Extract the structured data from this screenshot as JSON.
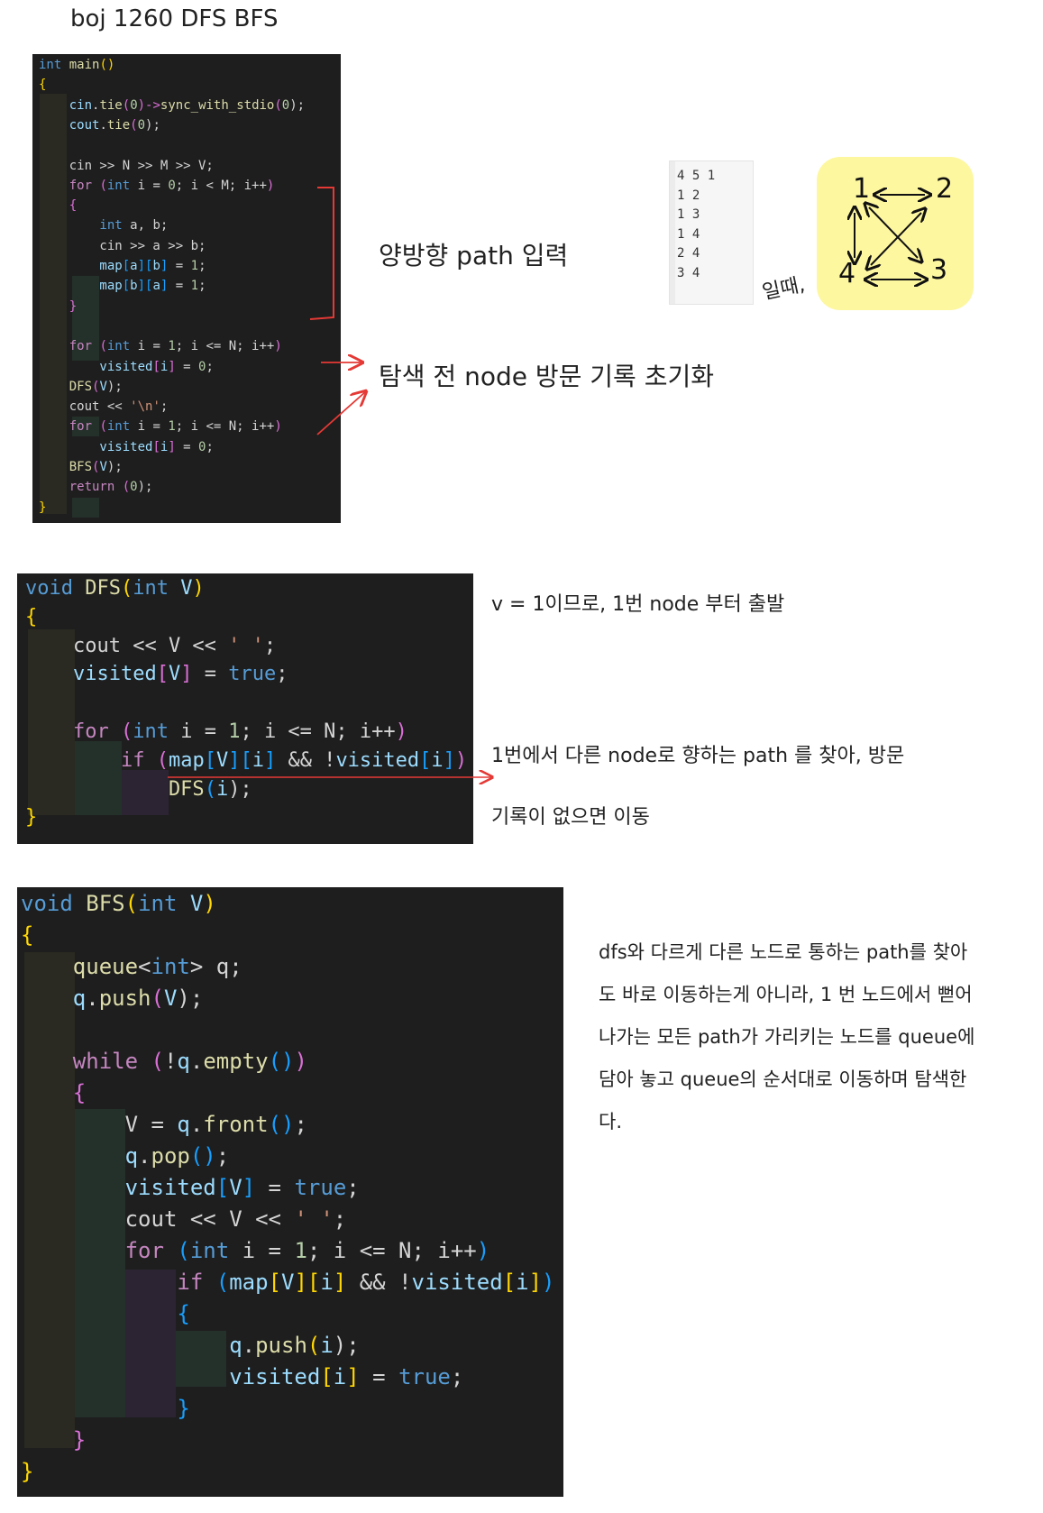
{
  "title": "boj 1260 DFS BFS",
  "main_code": {
    "lines": [
      [
        {
          "t": "int ",
          "c": "kw"
        },
        {
          "t": "main",
          "c": "fn"
        },
        {
          "t": "()",
          "c": "br"
        }
      ],
      [
        {
          "t": "{",
          "c": "br"
        }
      ],
      [
        {
          "t": "    cin",
          "c": "var"
        },
        {
          "t": ".",
          "c": "txt"
        },
        {
          "t": "tie",
          "c": "fn"
        },
        {
          "t": "(",
          "c": "br2"
        },
        {
          "t": "0",
          "c": "num"
        },
        {
          "t": ")->",
          "c": "br2"
        },
        {
          "t": "sync_with_stdio",
          "c": "fn"
        },
        {
          "t": "(",
          "c": "br2"
        },
        {
          "t": "0",
          "c": "num"
        },
        {
          "t": ");",
          "c": "txt"
        }
      ],
      [
        {
          "t": "    cout",
          "c": "var"
        },
        {
          "t": ".",
          "c": "txt"
        },
        {
          "t": "tie",
          "c": "fn"
        },
        {
          "t": "(",
          "c": "br2"
        },
        {
          "t": "0",
          "c": "num"
        },
        {
          "t": ");",
          "c": "txt"
        }
      ],
      [],
      [
        {
          "t": "    cin >> N >> M >> V;",
          "c": "txt"
        }
      ],
      [
        {
          "t": "    for ",
          "c": "ctl"
        },
        {
          "t": "(",
          "c": "br2"
        },
        {
          "t": "int ",
          "c": "kw"
        },
        {
          "t": "i = ",
          "c": "txt"
        },
        {
          "t": "0",
          "c": "num"
        },
        {
          "t": "; i < M; i++",
          "c": "txt"
        },
        {
          "t": ")",
          "c": "br2"
        }
      ],
      [
        {
          "t": "    {",
          "c": "br2"
        }
      ],
      [
        {
          "t": "        int ",
          "c": "kw"
        },
        {
          "t": "a, b;",
          "c": "txt"
        }
      ],
      [
        {
          "t": "        cin >> a >> b;",
          "c": "txt"
        }
      ],
      [
        {
          "t": "        map",
          "c": "var"
        },
        {
          "t": "[",
          "c": "br3"
        },
        {
          "t": "a",
          "c": "var"
        },
        {
          "t": "][",
          "c": "br3"
        },
        {
          "t": "b",
          "c": "var"
        },
        {
          "t": "]",
          "c": "br3"
        },
        {
          "t": " = ",
          "c": "txt"
        },
        {
          "t": "1",
          "c": "num"
        },
        {
          "t": ";",
          "c": "txt"
        }
      ],
      [
        {
          "t": "        map",
          "c": "var"
        },
        {
          "t": "[",
          "c": "br3"
        },
        {
          "t": "b",
          "c": "var"
        },
        {
          "t": "][",
          "c": "br3"
        },
        {
          "t": "a",
          "c": "var"
        },
        {
          "t": "]",
          "c": "br3"
        },
        {
          "t": " = ",
          "c": "txt"
        },
        {
          "t": "1",
          "c": "num"
        },
        {
          "t": ";",
          "c": "txt"
        }
      ],
      [
        {
          "t": "    }",
          "c": "br2"
        }
      ],
      [],
      [
        {
          "t": "    for ",
          "c": "ctl"
        },
        {
          "t": "(",
          "c": "br2"
        },
        {
          "t": "int ",
          "c": "kw"
        },
        {
          "t": "i = ",
          "c": "txt"
        },
        {
          "t": "1",
          "c": "num"
        },
        {
          "t": "; i <= N; i++",
          "c": "txt"
        },
        {
          "t": ")",
          "c": "br2"
        }
      ],
      [
        {
          "t": "        visited",
          "c": "var"
        },
        {
          "t": "[",
          "c": "br2"
        },
        {
          "t": "i",
          "c": "var"
        },
        {
          "t": "]",
          "c": "br2"
        },
        {
          "t": " = ",
          "c": "txt"
        },
        {
          "t": "0",
          "c": "num"
        },
        {
          "t": ";",
          "c": "txt"
        }
      ],
      [
        {
          "t": "    DFS",
          "c": "fn"
        },
        {
          "t": "(",
          "c": "br2"
        },
        {
          "t": "V",
          "c": "var"
        },
        {
          "t": ");",
          "c": "txt"
        }
      ],
      [
        {
          "t": "    cout << ",
          "c": "txt"
        },
        {
          "t": "'\\n'",
          "c": "str"
        },
        {
          "t": ";",
          "c": "txt"
        }
      ],
      [
        {
          "t": "    for ",
          "c": "ctl"
        },
        {
          "t": "(",
          "c": "br2"
        },
        {
          "t": "int ",
          "c": "kw"
        },
        {
          "t": "i = ",
          "c": "txt"
        },
        {
          "t": "1",
          "c": "num"
        },
        {
          "t": "; i <= N; i++",
          "c": "txt"
        },
        {
          "t": ")",
          "c": "br2"
        }
      ],
      [
        {
          "t": "        visited",
          "c": "var"
        },
        {
          "t": "[",
          "c": "br2"
        },
        {
          "t": "i",
          "c": "var"
        },
        {
          "t": "]",
          "c": "br2"
        },
        {
          "t": " = ",
          "c": "txt"
        },
        {
          "t": "0",
          "c": "num"
        },
        {
          "t": ";",
          "c": "txt"
        }
      ],
      [
        {
          "t": "    BFS",
          "c": "fn"
        },
        {
          "t": "(",
          "c": "br2"
        },
        {
          "t": "V",
          "c": "var"
        },
        {
          "t": ");",
          "c": "txt"
        }
      ],
      [
        {
          "t": "    return ",
          "c": "ctl"
        },
        {
          "t": "(",
          "c": "br2"
        },
        {
          "t": "0",
          "c": "num"
        },
        {
          "t": ");",
          "c": "txt"
        }
      ],
      [
        {
          "t": "}",
          "c": "br"
        }
      ]
    ]
  },
  "dfs_code": {
    "lines": [
      [
        {
          "t": "void ",
          "c": "kw"
        },
        {
          "t": "DFS",
          "c": "fn"
        },
        {
          "t": "(",
          "c": "br"
        },
        {
          "t": "int",
          "c": "kw"
        },
        {
          "t": " V",
          "c": "var"
        },
        {
          "t": ")",
          "c": "br"
        }
      ],
      [
        {
          "t": "{",
          "c": "br"
        }
      ],
      [
        {
          "t": "    cout << V << ",
          "c": "txt"
        },
        {
          "t": "' '",
          "c": "str"
        },
        {
          "t": ";",
          "c": "txt"
        }
      ],
      [
        {
          "t": "    visited",
          "c": "var"
        },
        {
          "t": "[",
          "c": "br2"
        },
        {
          "t": "V",
          "c": "var"
        },
        {
          "t": "]",
          "c": "br2"
        },
        {
          "t": " = ",
          "c": "txt"
        },
        {
          "t": "true",
          "c": "kw"
        },
        {
          "t": ";",
          "c": "txt"
        }
      ],
      [],
      [
        {
          "t": "    for ",
          "c": "ctl"
        },
        {
          "t": "(",
          "c": "br2"
        },
        {
          "t": "int",
          "c": "kw"
        },
        {
          "t": " i = ",
          "c": "txt"
        },
        {
          "t": "1",
          "c": "num"
        },
        {
          "t": "; i <= N; i++",
          "c": "txt"
        },
        {
          "t": ")",
          "c": "br2"
        }
      ],
      [
        {
          "t": "        if ",
          "c": "ctl"
        },
        {
          "t": "(",
          "c": "br2"
        },
        {
          "t": "map",
          "c": "var"
        },
        {
          "t": "[",
          "c": "br3"
        },
        {
          "t": "V",
          "c": "var"
        },
        {
          "t": "][",
          "c": "br3"
        },
        {
          "t": "i",
          "c": "var"
        },
        {
          "t": "]",
          "c": "br3"
        },
        {
          "t": " && !",
          "c": "txt"
        },
        {
          "t": "visited",
          "c": "var"
        },
        {
          "t": "[",
          "c": "br3"
        },
        {
          "t": "i",
          "c": "var"
        },
        {
          "t": "]",
          "c": "br3"
        },
        {
          "t": ")",
          "c": "br2"
        }
      ],
      [
        {
          "t": "            DFS",
          "c": "fn"
        },
        {
          "t": "(",
          "c": "br3"
        },
        {
          "t": "i",
          "c": "var"
        },
        {
          "t": ");",
          "c": "txt"
        }
      ],
      [
        {
          "t": "}",
          "c": "br"
        }
      ]
    ]
  },
  "bfs_code": {
    "lines": [
      [
        {
          "t": "void ",
          "c": "kw"
        },
        {
          "t": "BFS",
          "c": "fn"
        },
        {
          "t": "(",
          "c": "br"
        },
        {
          "t": "int",
          "c": "kw"
        },
        {
          "t": " V",
          "c": "var"
        },
        {
          "t": ")",
          "c": "br"
        }
      ],
      [
        {
          "t": "{",
          "c": "br"
        }
      ],
      [
        {
          "t": "    queue",
          "c": "fn"
        },
        {
          "t": "<",
          "c": "txt"
        },
        {
          "t": "int",
          "c": "kw"
        },
        {
          "t": "> q;",
          "c": "txt"
        }
      ],
      [
        {
          "t": "    q",
          "c": "var"
        },
        {
          "t": ".",
          "c": "txt"
        },
        {
          "t": "push",
          "c": "fn"
        },
        {
          "t": "(",
          "c": "br2"
        },
        {
          "t": "V",
          "c": "var"
        },
        {
          "t": ");",
          "c": "txt"
        }
      ],
      [],
      [
        {
          "t": "    while ",
          "c": "ctl"
        },
        {
          "t": "(",
          "c": "br2"
        },
        {
          "t": "!",
          "c": "txt"
        },
        {
          "t": "q",
          "c": "var"
        },
        {
          "t": ".",
          "c": "txt"
        },
        {
          "t": "empty",
          "c": "fn"
        },
        {
          "t": "()",
          "c": "br3"
        },
        {
          "t": ")",
          "c": "br2"
        }
      ],
      [
        {
          "t": "    {",
          "c": "br2"
        }
      ],
      [
        {
          "t": "        V = ",
          "c": "txt"
        },
        {
          "t": "q",
          "c": "var"
        },
        {
          "t": ".",
          "c": "txt"
        },
        {
          "t": "front",
          "c": "fn"
        },
        {
          "t": "()",
          "c": "br3"
        },
        {
          "t": ";",
          "c": "txt"
        }
      ],
      [
        {
          "t": "        q",
          "c": "var"
        },
        {
          "t": ".",
          "c": "txt"
        },
        {
          "t": "pop",
          "c": "fn"
        },
        {
          "t": "()",
          "c": "br3"
        },
        {
          "t": ";",
          "c": "txt"
        }
      ],
      [
        {
          "t": "        visited",
          "c": "var"
        },
        {
          "t": "[",
          "c": "br3"
        },
        {
          "t": "V",
          "c": "var"
        },
        {
          "t": "]",
          "c": "br3"
        },
        {
          "t": " = ",
          "c": "txt"
        },
        {
          "t": "true",
          "c": "kw"
        },
        {
          "t": ";",
          "c": "txt"
        }
      ],
      [
        {
          "t": "        cout << V << ",
          "c": "txt"
        },
        {
          "t": "' '",
          "c": "str"
        },
        {
          "t": ";",
          "c": "txt"
        }
      ],
      [
        {
          "t": "        for ",
          "c": "ctl"
        },
        {
          "t": "(",
          "c": "br3"
        },
        {
          "t": "int",
          "c": "kw"
        },
        {
          "t": " i = ",
          "c": "txt"
        },
        {
          "t": "1",
          "c": "num"
        },
        {
          "t": "; i <= N; i++",
          "c": "txt"
        },
        {
          "t": ")",
          "c": "br3"
        }
      ],
      [
        {
          "t": "            if ",
          "c": "ctl"
        },
        {
          "t": "(",
          "c": "br3"
        },
        {
          "t": "map",
          "c": "var"
        },
        {
          "t": "[",
          "c": "br"
        },
        {
          "t": "V",
          "c": "var"
        },
        {
          "t": "][",
          "c": "br"
        },
        {
          "t": "i",
          "c": "var"
        },
        {
          "t": "]",
          "c": "br"
        },
        {
          "t": " && !",
          "c": "txt"
        },
        {
          "t": "visited",
          "c": "var"
        },
        {
          "t": "[",
          "c": "br"
        },
        {
          "t": "i",
          "c": "var"
        },
        {
          "t": "]",
          "c": "br"
        },
        {
          "t": ")",
          "c": "br3"
        }
      ],
      [
        {
          "t": "            {",
          "c": "br3"
        }
      ],
      [
        {
          "t": "                q",
          "c": "var"
        },
        {
          "t": ".",
          "c": "txt"
        },
        {
          "t": "push",
          "c": "fn"
        },
        {
          "t": "(",
          "c": "br"
        },
        {
          "t": "i",
          "c": "var"
        },
        {
          "t": ");",
          "c": "txt"
        }
      ],
      [
        {
          "t": "                visited",
          "c": "var"
        },
        {
          "t": "[",
          "c": "br"
        },
        {
          "t": "i",
          "c": "var"
        },
        {
          "t": "]",
          "c": "br"
        },
        {
          "t": " = ",
          "c": "txt"
        },
        {
          "t": "true",
          "c": "kw"
        },
        {
          "t": ";",
          "c": "txt"
        }
      ],
      [
        {
          "t": "            }",
          "c": "br3"
        }
      ],
      [
        {
          "t": "    }",
          "c": "br2"
        }
      ],
      [
        {
          "t": "}",
          "c": "br"
        }
      ]
    ]
  },
  "notes": {
    "bidirectional": "양방향 path 입력",
    "reset_visited": "탐색 전 node 방문 기록 초기화",
    "when": "일때,",
    "dfs_start": "v = 1이므로, 1번 node 부터 출발",
    "dfs_move_1": "1번에서 다른 node로 향하는 path 를 찾아, 방문",
    "dfs_move_2": "기록이 없으면 이동",
    "bfs_desc": [
      "dfs와 다르게 다른 노드로 통하는 path를 찾아",
      "도 바로 이동하는게 아니라, 1 번 노드에서 뻗어",
      "나가는 모든 path가 가리키는 노드를 queue에",
      "담아 놓고 queue의 순서대로 이동하며 탐색한",
      "다."
    ]
  },
  "sample_input": [
    "4 5 1",
    "1 2",
    "1 3",
    "1 4",
    "2 4",
    "3 4"
  ],
  "graph": {
    "nodes": [
      "1",
      "2",
      "3",
      "4"
    ],
    "edges": [
      [
        "1",
        "2"
      ],
      [
        "1",
        "3"
      ],
      [
        "1",
        "4"
      ],
      [
        "2",
        "4"
      ],
      [
        "3",
        "4"
      ]
    ]
  },
  "colors": {
    "code_bg": "#1e1e1e",
    "arrow_red": "#e53935",
    "graph_bg": "#fdf7a0"
  }
}
